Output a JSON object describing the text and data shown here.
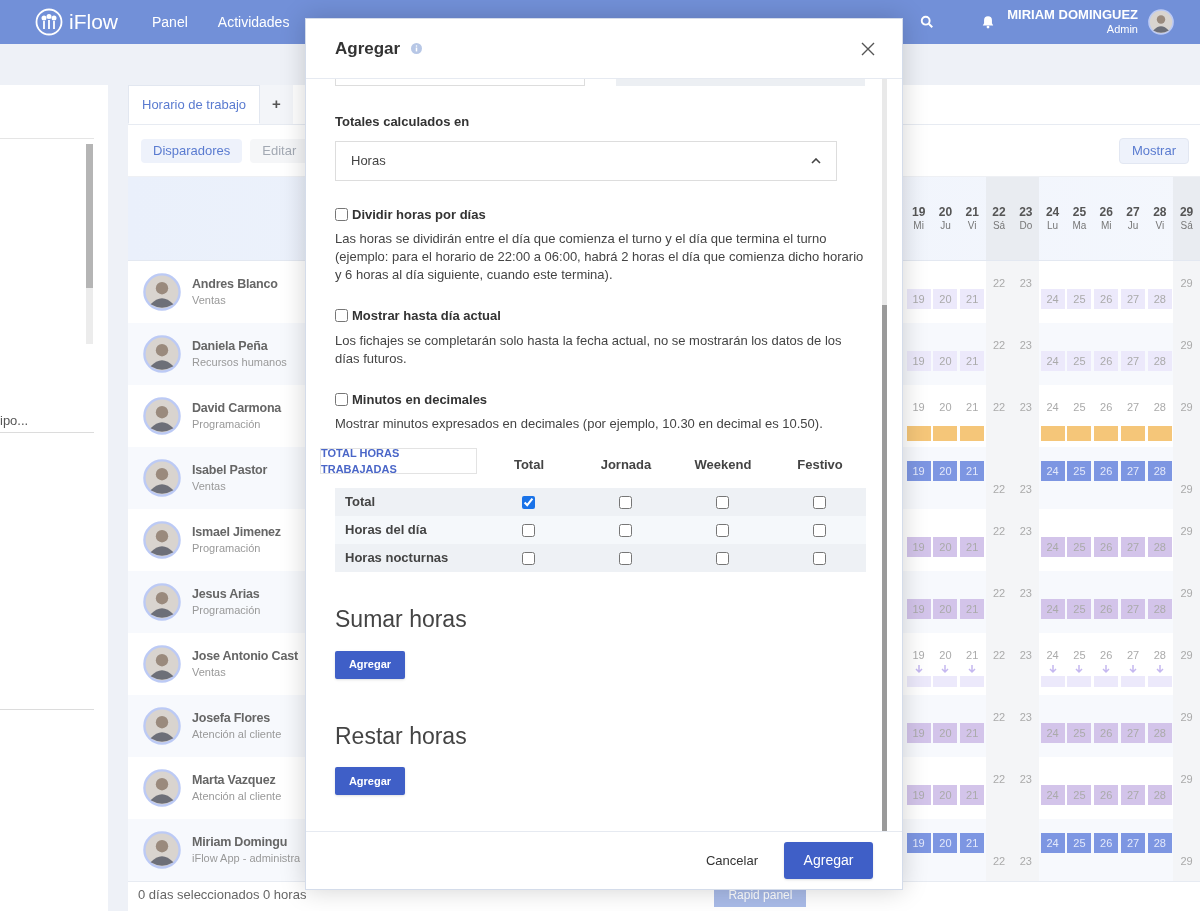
{
  "nav": {
    "logo": "iFlow",
    "items": [
      {
        "label": "Panel",
        "selected": false
      },
      {
        "label": "Actividades",
        "selected": false
      }
    ],
    "user": {
      "name": "MIRIAM DOMINGUEZ",
      "role": "Admin"
    }
  },
  "sidebar": {
    "search_text": "ipo..."
  },
  "schedule": {
    "tabs": [
      {
        "label": "Horario de trabajo",
        "selected": true
      },
      {
        "label": "+",
        "selected": false
      }
    ],
    "actions": [
      {
        "label": "Disparadores",
        "disabled": false
      },
      {
        "label": "Editar",
        "disabled": true
      }
    ],
    "show_button": "Mostrar",
    "days": [
      {
        "day": "19",
        "dow": "Mi",
        "weekend": false
      },
      {
        "day": "20",
        "dow": "Ju",
        "weekend": false
      },
      {
        "day": "21",
        "dow": "Vi",
        "weekend": false
      },
      {
        "day": "22",
        "dow": "Sá",
        "weekend": true
      },
      {
        "day": "23",
        "dow": "Do",
        "weekend": true
      },
      {
        "day": "24",
        "dow": "Lu",
        "weekend": false
      },
      {
        "day": "25",
        "dow": "Ma",
        "weekend": false
      },
      {
        "day": "26",
        "dow": "Mi",
        "weekend": false
      },
      {
        "day": "27",
        "dow": "Ju",
        "weekend": false
      },
      {
        "day": "28",
        "dow": "Vi",
        "weekend": false
      },
      {
        "day": "29",
        "dow": "Sá",
        "weekend": true
      }
    ],
    "employees": [
      {
        "name": "Andres Blanco",
        "department": "Ventas",
        "kind": "light",
        "days": [
          "19",
          "20",
          "21",
          "22",
          "23",
          "24",
          "25",
          "26",
          "27",
          "28",
          "29"
        ]
      },
      {
        "name": "Daniela Peña",
        "department": "Recursos humanos",
        "kind": "light",
        "days": [
          "19",
          "20",
          "21",
          "22",
          "23",
          "24",
          "25",
          "26",
          "27",
          "28",
          "29"
        ]
      },
      {
        "name": "David Carmona",
        "department": "Programación",
        "kind": "orange",
        "days": [
          "19",
          "20",
          "21",
          "22",
          "23",
          "24",
          "25",
          "26",
          "27",
          "28",
          "29"
        ]
      },
      {
        "name": "Isabel Pastor",
        "department": "Ventas",
        "kind": "blue",
        "days": [
          "19",
          "20",
          "21",
          "22",
          "23",
          "24",
          "25",
          "26",
          "27",
          "28",
          "29"
        ]
      },
      {
        "name": "Ismael Jimenez",
        "department": "Programación",
        "kind": "purple",
        "days": [
          "19",
          "20",
          "21",
          "22",
          "23",
          "24",
          "25",
          "26",
          "27",
          "28",
          "29"
        ]
      },
      {
        "name": "Jesus Arias",
        "department": "Programación",
        "kind": "purple",
        "days": [
          "19",
          "20",
          "21",
          "22",
          "23",
          "24",
          "25",
          "26",
          "27",
          "28",
          "29"
        ]
      },
      {
        "name": "Jose Antonio Cast",
        "department": "Ventas",
        "kind": "arrows",
        "days": [
          "19",
          "20",
          "21",
          "22",
          "23",
          "24",
          "25",
          "26",
          "27",
          "28",
          "29"
        ]
      },
      {
        "name": "Josefa Flores",
        "department": "Atención al cliente",
        "kind": "purple",
        "days": [
          "19",
          "20",
          "21",
          "22",
          "23",
          "24",
          "25",
          "26",
          "27",
          "28",
          "29"
        ]
      },
      {
        "name": "Marta Vazquez",
        "department": "Atención al cliente",
        "kind": "purple",
        "days": [
          "19",
          "20",
          "21",
          "22",
          "23",
          "24",
          "25",
          "26",
          "27",
          "28",
          "29"
        ]
      },
      {
        "name": "Miriam Domingu",
        "department": "iFlow App - administra",
        "kind": "blue",
        "days": [
          "19",
          "20",
          "21",
          "22",
          "23",
          "24",
          "25",
          "26",
          "27",
          "28",
          "29"
        ]
      }
    ],
    "footer_text": "0 días seleccionados 0 horas",
    "footer_button": "Rapid panel"
  },
  "modal": {
    "title": "Agregar",
    "totals_label": "Totales calculados en",
    "totals_select": "Horas",
    "options": [
      {
        "label": "Dividir horas por días",
        "checked": false,
        "description": "Las horas se dividirán entre el día que comienza el turno y el día que termina el turno (ejemplo: para el horario de 22:00 a 06:00, habrá 2 horas el día que comienza dicho horario y 6 horas al día siguiente, cuando este termina)."
      },
      {
        "label": "Mostrar hasta día actual",
        "checked": false,
        "description": "Los fichajes se completarán solo hasta la fecha actual, no se mostrarán los datos de los días futuros."
      },
      {
        "label": "Minutos en decimales",
        "checked": false,
        "description": "Mostrar minutos expresados en decimales (por ejemplo, 10.30 en decimal es 10.50)."
      }
    ],
    "table": {
      "tab": "TOTAL HORAS TRABAJADAS",
      "columns": [
        "Total",
        "Jornada",
        "Weekend",
        "Festivo"
      ],
      "rows": [
        {
          "label": "Total",
          "cells": [
            {
              "checked": true
            },
            {
              "checked": false
            },
            {
              "checked": false
            },
            {
              "checked": false
            }
          ]
        },
        {
          "label": "Horas del día",
          "cells": [
            {
              "checked": false
            },
            {
              "checked": false
            },
            {
              "checked": false
            },
            {
              "checked": false
            }
          ]
        },
        {
          "label": "Horas nocturnas",
          "cells": [
            {
              "checked": false
            },
            {
              "checked": false
            },
            {
              "checked": false
            },
            {
              "checked": false
            }
          ]
        }
      ]
    },
    "sections": [
      {
        "title": "Sumar horas",
        "button": "Agregar"
      },
      {
        "title": "Restar horas",
        "button": "Agregar"
      }
    ],
    "cancel": "Cancelar",
    "submit": "Agregar"
  }
}
